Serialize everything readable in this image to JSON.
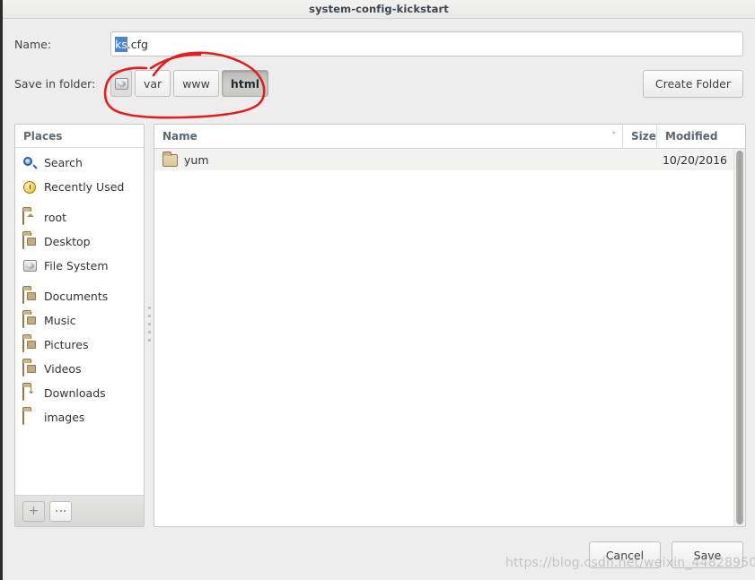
{
  "window": {
    "title": "system-config-kickstart"
  },
  "form": {
    "name_label": "Name:",
    "name_value_selected": "ks",
    "name_value_rest": ".cfg",
    "folder_label": "Save in folder:",
    "create_folder_label": "Create Folder"
  },
  "breadcrumb": {
    "items": [
      {
        "label": "",
        "icon": "hard-drive-icon",
        "active": false
      },
      {
        "label": "var",
        "icon": "",
        "active": false
      },
      {
        "label": "www",
        "icon": "",
        "active": false
      },
      {
        "label": "html",
        "icon": "",
        "active": true
      }
    ]
  },
  "sidebar": {
    "header": "Places",
    "items": [
      {
        "label": "Search",
        "icon": "search-icon"
      },
      {
        "label": "Recently Used",
        "icon": "recent-clock-icon"
      },
      {
        "label": "root",
        "icon": "home-folder-icon"
      },
      {
        "label": "Desktop",
        "icon": "desktop-folder-icon"
      },
      {
        "label": "File System",
        "icon": "hard-drive-icon"
      },
      {
        "label": "Documents",
        "icon": "documents-folder-icon"
      },
      {
        "label": "Music",
        "icon": "music-folder-icon"
      },
      {
        "label": "Pictures",
        "icon": "pictures-folder-icon"
      },
      {
        "label": "Videos",
        "icon": "videos-folder-icon"
      },
      {
        "label": "Downloads",
        "icon": "downloads-folder-icon"
      },
      {
        "label": "images",
        "icon": "folder-icon"
      }
    ],
    "add_button": "+",
    "remove_button": "–"
  },
  "filelist": {
    "columns": {
      "name": "Name",
      "size": "Size",
      "modified": "Modified",
      "sort_indicator": "˅"
    },
    "rows": [
      {
        "name": "yum",
        "size": "",
        "modified": "10/20/2016",
        "icon": "folder-icon"
      }
    ]
  },
  "footer": {
    "cancel_label": "Cancel",
    "save_label": "Save"
  },
  "watermark": {
    "text": "https://blog.csdn.net/weixin_44828950"
  },
  "colors": {
    "selection_blue": "#4a86cf",
    "annotation_red": "#e02020",
    "dialog_bg": "#ededed",
    "title_text": "#3c4550"
  }
}
